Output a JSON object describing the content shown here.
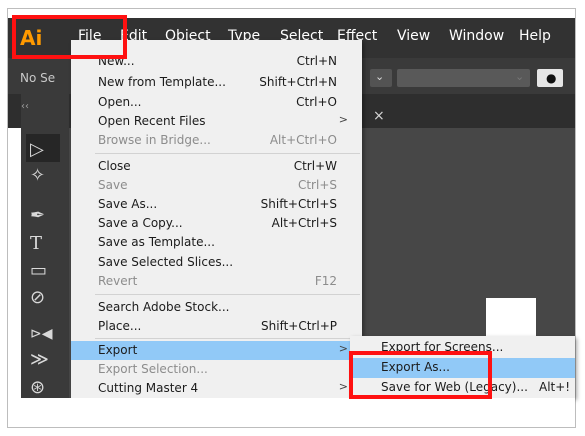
{
  "app": {
    "logo": "Ai",
    "menubar": [
      "File",
      "Edit",
      "Object",
      "Type",
      "Select",
      "Effect",
      "View",
      "Window",
      "Help"
    ]
  },
  "options_bar": {
    "selection_label": "No Se"
  },
  "panel": {
    "collapse_label": "‹‹",
    "close_label": "×"
  },
  "tools": [
    "selection-icon",
    "magic-wand-icon",
    "pen-icon",
    "type-icon",
    "rectangle-icon",
    "shaper-icon",
    "width-icon",
    "warp-icon",
    "symbol-sprayer-icon"
  ],
  "file_menu": {
    "items": [
      {
        "label": "New...",
        "shortcut": "Ctrl+N",
        "disabled": false
      },
      {
        "label": "New from Template...",
        "shortcut": "Shift+Ctrl+N",
        "disabled": false
      },
      {
        "label": "Open...",
        "shortcut": "Ctrl+O",
        "disabled": false
      },
      {
        "label": "Open Recent Files",
        "shortcut": ">",
        "disabled": false
      },
      {
        "label": "Browse in Bridge...",
        "shortcut": "Alt+Ctrl+O",
        "disabled": true
      },
      {
        "label": "Close",
        "shortcut": "Ctrl+W",
        "disabled": false
      },
      {
        "label": "Save",
        "shortcut": "Ctrl+S",
        "disabled": true
      },
      {
        "label": "Save As...",
        "shortcut": "Shift+Ctrl+S",
        "disabled": false
      },
      {
        "label": "Save a Copy...",
        "shortcut": "Alt+Ctrl+S",
        "disabled": false
      },
      {
        "label": "Save as Template...",
        "shortcut": "",
        "disabled": false
      },
      {
        "label": "Save Selected Slices...",
        "shortcut": "",
        "disabled": false
      },
      {
        "label": "Revert",
        "shortcut": "F12",
        "disabled": true
      },
      {
        "label": "Search Adobe Stock...",
        "shortcut": "",
        "disabled": false
      },
      {
        "label": "Place...",
        "shortcut": "Shift+Ctrl+P",
        "disabled": false
      },
      {
        "label": "Export",
        "shortcut": ">",
        "disabled": false
      },
      {
        "label": "Export Selection...",
        "shortcut": "",
        "disabled": true
      },
      {
        "label": "Cutting Master 4",
        "shortcut": ">",
        "disabled": false
      }
    ]
  },
  "export_submenu": {
    "items": [
      {
        "label": "Export for Screens...",
        "shortcut": ""
      },
      {
        "label": "Export As...",
        "shortcut": ""
      },
      {
        "label": "Save for Web (Legacy)...",
        "shortcut": "Alt+!"
      }
    ]
  },
  "colors": {
    "menubar": "#323232",
    "highlight": "#91c9f7",
    "accent": "#ff9a00",
    "annotation": "#ff1111"
  }
}
